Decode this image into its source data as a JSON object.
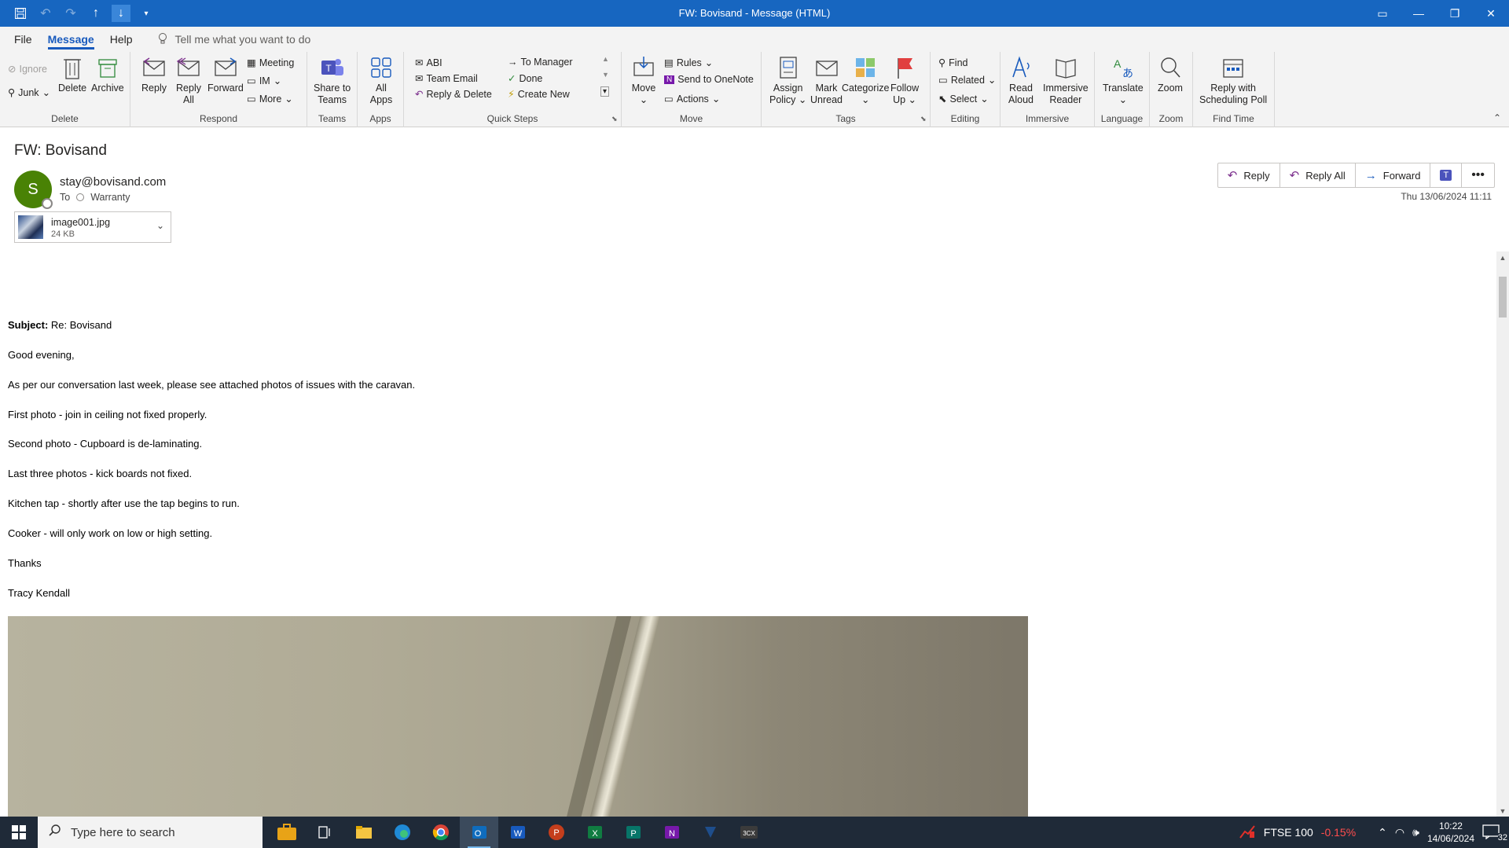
{
  "window": {
    "title": "FW: Bovisand  -  Message (HTML)"
  },
  "menu": {
    "tabs": [
      "File",
      "Message",
      "Help"
    ],
    "tell_me": "Tell me what you want to do"
  },
  "ribbon": {
    "delete": {
      "label": "Delete",
      "ignore": "Ignore",
      "junk": "Junk",
      "delete": "Delete",
      "archive": "Archive"
    },
    "respond": {
      "label": "Respond",
      "reply": "Reply",
      "reply_all_1": "Reply",
      "reply_all_2": "All",
      "forward": "Forward",
      "meeting": "Meeting",
      "im": "IM",
      "more": "More"
    },
    "teams": {
      "label": "Teams",
      "share_1": "Share to",
      "share_2": "Teams"
    },
    "apps": {
      "label": "Apps",
      "all_1": "All",
      "all_2": "Apps"
    },
    "quick_steps": {
      "label": "Quick Steps",
      "items": [
        "ABI",
        "To Manager",
        "Team Email",
        "Done",
        "Reply & Delete",
        "Create New"
      ]
    },
    "move": {
      "label": "Move",
      "move": "Move",
      "rules": "Rules",
      "onenote": "Send to OneNote",
      "actions": "Actions"
    },
    "tags": {
      "label": "Tags",
      "assign_1": "Assign",
      "assign_2": "Policy",
      "mark_1": "Mark",
      "mark_2": "Unread",
      "categorize": "Categorize",
      "follow_1": "Follow",
      "follow_2": "Up"
    },
    "editing": {
      "label": "Editing",
      "find": "Find",
      "related": "Related",
      "select": "Select"
    },
    "immersive": {
      "label": "Immersive",
      "read_1": "Read",
      "read_2": "Aloud",
      "reader_1": "Immersive",
      "reader_2": "Reader"
    },
    "language": {
      "label": "Language",
      "translate": "Translate"
    },
    "zoom": {
      "label": "Zoom",
      "zoom": "Zoom"
    },
    "find_time": {
      "label": "Find Time",
      "poll_1": "Reply with",
      "poll_2": "Scheduling Poll"
    }
  },
  "message": {
    "subject": "FW: Bovisand",
    "avatar_initial": "S",
    "sender": "stay@bovisand.com",
    "to_label": "To",
    "to_value": "Warranty",
    "date": "Thu 13/06/2024 11:11",
    "attachment": {
      "name": "image001.jpg",
      "size": "24 KB"
    },
    "actions": {
      "reply": "Reply",
      "reply_all": "Reply All",
      "forward": "Forward"
    }
  },
  "body": {
    "subject_label": "Subject:",
    "subject_value": " Re: Bovisand",
    "lines": [
      "Good evening,",
      "As per our conversation last week, please see attached photos of issues with the caravan.",
      "First photo - join in ceiling not fixed properly.",
      "Second photo - Cupboard is de-laminating.",
      "Last three photos - kick boards not fixed.",
      "Kitchen tap - shortly after use the tap begins to run.",
      "Cooker - will only work on low or high setting.",
      "Thanks",
      "Tracy Kendall"
    ]
  },
  "taskbar": {
    "search_placeholder": "Type here to search",
    "ticker_name": "FTSE 100",
    "ticker_change": "-0.15%",
    "time": "10:22",
    "date": "14/06/2024",
    "notifications": "32"
  }
}
